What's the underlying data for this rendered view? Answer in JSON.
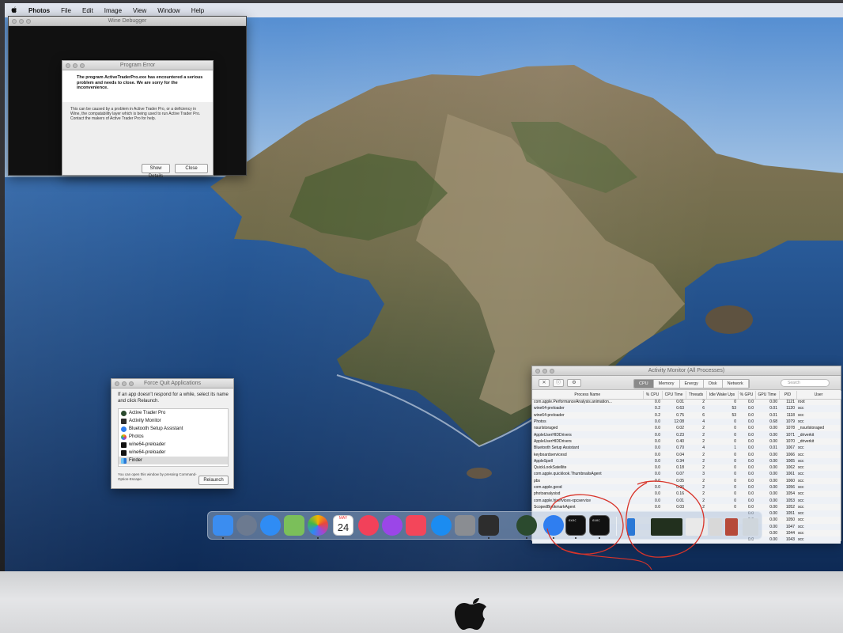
{
  "menubar": {
    "apple": "",
    "app": "Photos",
    "items": [
      "File",
      "Edit",
      "Image",
      "View",
      "Window",
      "Help"
    ]
  },
  "wine_debugger": {
    "title": "Wine Debugger"
  },
  "program_error": {
    "title": "Program Error",
    "headline": "The program ActiveTraderPro.exe has encountered a serious problem and needs to close. We are sorry for the inconvenience.",
    "body": "This can be caused by a problem in Active Trader Pro, or a deficiency in Wine, the compatability layer which is being used to run Active Trader Pro. Contact the makers of Active Trader Pro for help.",
    "show_details_label": "Show Details",
    "close_label": "Close"
  },
  "force_quit": {
    "title": "Force Quit Applications",
    "intro": "If an app doesn't respond for a while, select its name and click Relaunch.",
    "apps": [
      {
        "name": "Active Trader Pro",
        "icon": "atp-icon"
      },
      {
        "name": "Activity Monitor",
        "icon": "activity-monitor-icon"
      },
      {
        "name": "Bluetooth Setup Assistant",
        "icon": "bluetooth-icon"
      },
      {
        "name": "Photos",
        "icon": "photos-icon"
      },
      {
        "name": "wine64-preloader",
        "icon": "terminal-icon"
      },
      {
        "name": "wine64-preloader",
        "icon": "terminal-icon"
      },
      {
        "name": "Finder",
        "icon": "finder-icon"
      }
    ],
    "hint": "You can open this window by pressing Command-Option-Escape.",
    "relaunch_label": "Relaunch"
  },
  "activity_monitor": {
    "title": "Activity Monitor (All Processes)",
    "tabs": [
      "CPU",
      "Memory",
      "Energy",
      "Disk",
      "Network"
    ],
    "active_tab": "CPU",
    "search_placeholder": "Search",
    "columns": [
      "Process Name",
      "% CPU",
      "CPU Time",
      "Threads",
      "Idle Wake Ups",
      "% GPU",
      "GPU Time",
      "PID",
      "User"
    ],
    "rows": [
      [
        "com.apple.PerformanceAnalysis.animation...",
        "0.0",
        "0.01",
        "2",
        "0",
        "0.0",
        "0.00",
        "1121",
        "root"
      ],
      [
        "wine64-preloader",
        "0.2",
        "0.63",
        "6",
        "53",
        "0.0",
        "0.01",
        "1120",
        "scc"
      ],
      [
        "wine64-preloader",
        "0.2",
        "0.75",
        "6",
        "53",
        "0.0",
        "0.01",
        "1118",
        "scc"
      ],
      [
        "Photos",
        "0.0",
        "12.08",
        "4",
        "0",
        "0.0",
        "0.68",
        "1079",
        "scc"
      ],
      [
        "nsurlstoraged",
        "0.0",
        "0.02",
        "2",
        "0",
        "0.0",
        "0.00",
        "1078",
        "_nsurlstoraged"
      ],
      [
        "AppleUserHIDDrivers",
        "0.0",
        "0.23",
        "2",
        "0",
        "0.0",
        "0.00",
        "1071",
        "_driverkit"
      ],
      [
        "AppleUserHIDDrivers",
        "0.0",
        "0.40",
        "2",
        "0",
        "0.0",
        "0.00",
        "1070",
        "_driverkit"
      ],
      [
        "Bluetooth Setup Assistant",
        "0.0",
        "0.70",
        "4",
        "1",
        "0.0",
        "0.01",
        "1067",
        "scc"
      ],
      [
        "keyboardservicesd",
        "0.0",
        "0.04",
        "2",
        "0",
        "0.0",
        "0.00",
        "1066",
        "scc"
      ],
      [
        "AppleSpell",
        "0.0",
        "0.34",
        "2",
        "0",
        "0.0",
        "0.00",
        "1065",
        "scc"
      ],
      [
        "QuickLookSatellite",
        "0.0",
        "0.18",
        "2",
        "0",
        "0.0",
        "0.00",
        "1062",
        "scc"
      ],
      [
        "com.apple.quicklook.ThumbnailsAgent",
        "0.0",
        "0.07",
        "3",
        "0",
        "0.0",
        "0.00",
        "1061",
        "scc"
      ],
      [
        "pbs",
        "0.0",
        "0.05",
        "2",
        "0",
        "0.0",
        "0.00",
        "1060",
        "scc"
      ],
      [
        "com.apple.geod",
        "0.0",
        "0.06",
        "2",
        "0",
        "0.0",
        "0.00",
        "1056",
        "scc"
      ],
      [
        "photoanalysisd",
        "0.0",
        "0.16",
        "2",
        "0",
        "0.0",
        "0.00",
        "1054",
        "scc"
      ],
      [
        "com.apple.hiservices-xpcservice",
        "0.0",
        "0.01",
        "2",
        "0",
        "0.0",
        "0.00",
        "1053",
        "scc"
      ],
      [
        "ScopedBookmarkAgent",
        "0.0",
        "0.03",
        "2",
        "0",
        "0.0",
        "0.00",
        "1052",
        "scc"
      ],
      [
        "",
        "",
        "",
        "",
        "",
        "0.0",
        "0.00",
        "1051",
        "scc"
      ],
      [
        "",
        "",
        "",
        "",
        "",
        "0.0",
        "0.00",
        "1050",
        "scc"
      ],
      [
        "",
        "",
        "",
        "",
        "",
        "0.0",
        "0.00",
        "1047",
        "scc"
      ],
      [
        "",
        "",
        "",
        "",
        "",
        "0.0",
        "0.00",
        "1044",
        "scc"
      ],
      [
        "",
        "",
        "",
        "",
        "",
        "0.0",
        "0.00",
        "1043",
        "scc"
      ]
    ]
  },
  "dock": {
    "calendar_month": "MAY",
    "calendar_day": "24",
    "apps": [
      {
        "name": "finder",
        "icon": "finder-icon",
        "color": "#3b8df0"
      },
      {
        "name": "launchpad",
        "icon": "rocket-icon",
        "color": "#6c7a90"
      },
      {
        "name": "safari",
        "icon": "compass-icon",
        "color": "#2f8cf4"
      },
      {
        "name": "maps",
        "icon": "map-icon",
        "color": "#7bbf5a"
      },
      {
        "name": "photos",
        "icon": "photos-icon",
        "color": "#f3f3f3"
      },
      {
        "name": "calendar",
        "icon": "calendar-icon",
        "color": "#ffffff"
      },
      {
        "name": "music",
        "icon": "music-note-icon",
        "color": "#f2415a"
      },
      {
        "name": "podcasts",
        "icon": "podcast-icon",
        "color": "#9b46e8"
      },
      {
        "name": "news",
        "icon": "news-icon",
        "color": "#f3465a"
      },
      {
        "name": "app store",
        "icon": "app-store-icon",
        "color": "#1b8cf1"
      },
      {
        "name": "system preferences",
        "icon": "gear-icon",
        "color": "#8a8d92"
      },
      {
        "name": "activity monitor",
        "icon": "activity-icon",
        "color": "#2d2d2d"
      },
      {
        "name": "active trader pro",
        "icon": "atp-icon",
        "color": "#2b4a2e"
      },
      {
        "name": "bluetooth setup",
        "icon": "bluetooth-icon",
        "color": "#2f7ef0"
      },
      {
        "name": "wine64-preloader",
        "icon": "terminal-icon",
        "color": "#111111"
      },
      {
        "name": "wine64-preloader",
        "icon": "terminal-icon",
        "color": "#111111"
      }
    ],
    "terminal_text": "exec"
  }
}
